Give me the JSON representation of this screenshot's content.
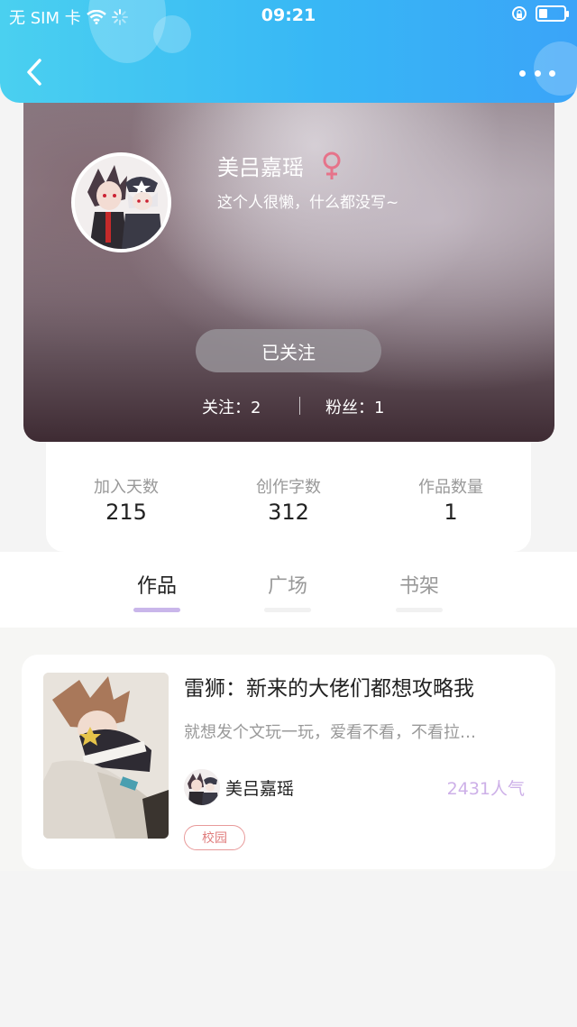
{
  "status_bar": {
    "carrier": "无 SIM 卡",
    "time": "09:21"
  },
  "nav": {
    "back_icon": "chevron-left-icon",
    "more_icon": "more-horizontal-icon"
  },
  "profile": {
    "nickname": "美吕嘉瑶",
    "gender_icon": "female-icon",
    "bio": "这个人很懒，什么都没写~",
    "follow_button": "已关注",
    "following_label": "关注：2",
    "fans_label": "粉丝：1"
  },
  "stats": [
    {
      "label": "加入天数",
      "value": "215"
    },
    {
      "label": "创作字数",
      "value": "312"
    },
    {
      "label": "作品数量",
      "value": "1"
    }
  ],
  "tabs": [
    {
      "label": "作品",
      "active": true
    },
    {
      "label": "广场",
      "active": false
    },
    {
      "label": "书架",
      "active": false
    }
  ],
  "works": [
    {
      "title": "雷狮：新来的大佬们都想攻略我",
      "description": "就想发个文玩一玩，爱看不看，不看拉…",
      "author": "美吕嘉瑶",
      "popularity": "2431人气",
      "tag": "校园"
    }
  ],
  "colors": {
    "header_gradient_start": "#4ad0f0",
    "header_gradient_end": "#3aa4f8",
    "tab_active_bar": "#c9b6ea",
    "popularity": "#cdb0e8",
    "tag_border": "#e89a9a",
    "gender_icon": "#e6738a"
  }
}
